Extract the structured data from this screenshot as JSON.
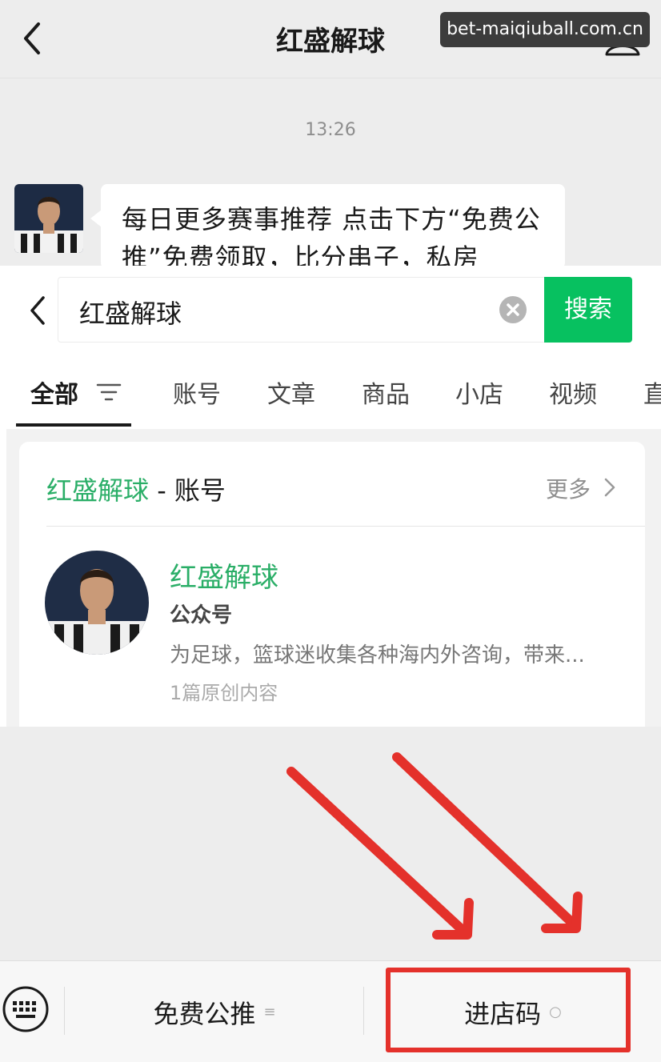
{
  "chat_header": {
    "title": "红盛解球",
    "watermark": "bet-maiqiuball.com.cn",
    "back_icon": "chevron-left-icon",
    "profile_icon": "person-icon"
  },
  "chat": {
    "timestamp": "13:26",
    "message_text": "每日更多赛事推荐 点击下方“免费公推”免费领取，比分串子，私房"
  },
  "search": {
    "back_icon": "chevron-left-icon",
    "query": "红盛解球",
    "clear_icon": "clear-icon",
    "button_label": "搜索",
    "tabs": [
      "全部",
      "账号",
      "文章",
      "商品",
      "小店",
      "视频",
      "直"
    ],
    "active_tab": "全部",
    "accent_color": "#07c160"
  },
  "result_card": {
    "section_name": "红盛解球",
    "section_suffix": " - 账号",
    "more_label": "更多",
    "account_name": "红盛解球",
    "account_type": "公众号",
    "description": "为足球，篮球迷收集各种海内外咨询，带来...",
    "original_count": "1篇原创内容"
  },
  "menu_bar": {
    "items": [
      {
        "label": "免费公推",
        "glyph": "≡"
      },
      {
        "label": "进店码",
        "glyph": "○"
      }
    ],
    "keyboard_icon": "keyboard-icon",
    "highlight_color": "#e4312b"
  }
}
